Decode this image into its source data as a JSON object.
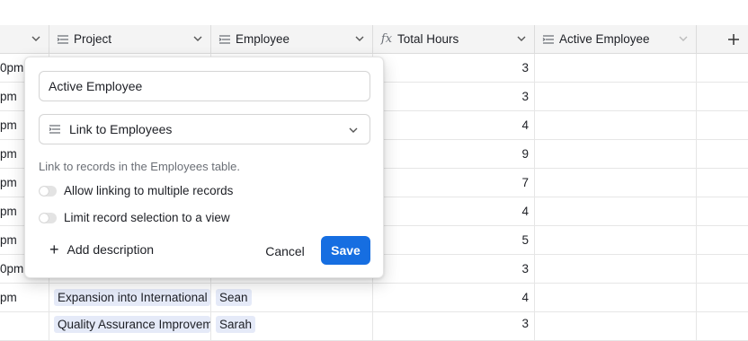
{
  "columns": [
    {
      "label": "",
      "icon": "chevron-down-icon"
    },
    {
      "label": "Project",
      "icon": "link-field-icon"
    },
    {
      "label": "Employee",
      "icon": "link-field-icon"
    },
    {
      "label": "Total Hours",
      "icon": "formula-icon"
    },
    {
      "label": "Active Employee",
      "icon": "link-field-icon"
    }
  ],
  "rows": [
    {
      "time": "0pm",
      "hours": "3",
      "project": "",
      "employee": ""
    },
    {
      "time": "pm",
      "hours": "3",
      "project": "",
      "employee": ""
    },
    {
      "time": "pm",
      "hours": "4",
      "project": "",
      "employee": ""
    },
    {
      "time": "pm",
      "hours": "9",
      "project": "",
      "employee": ""
    },
    {
      "time": "pm",
      "hours": "7",
      "project": "",
      "employee": ""
    },
    {
      "time": "pm",
      "hours": "4",
      "project": "",
      "employee": ""
    },
    {
      "time": "pm",
      "hours": "5",
      "project": "",
      "employee": ""
    },
    {
      "time": "0pm",
      "hours": "3",
      "project": "",
      "employee": ""
    },
    {
      "time": "pm",
      "hours": "4",
      "project": "Expansion into International",
      "employee": "Sean"
    },
    {
      "time": "",
      "hours": "3",
      "project": "Quality Assurance Improvement",
      "employee": "Sarah"
    }
  ],
  "popup": {
    "field_name": "Active Employee",
    "field_type": "Link to Employees",
    "description": "Link to records in the Employees table.",
    "toggle_multiple": "Allow linking to multiple records",
    "toggle_view": "Limit record selection to a view",
    "add_description": "Add description",
    "cancel": "Cancel",
    "save": "Save"
  },
  "colors": {
    "accent": "#166ee1",
    "pill": "#e5eaf8"
  }
}
